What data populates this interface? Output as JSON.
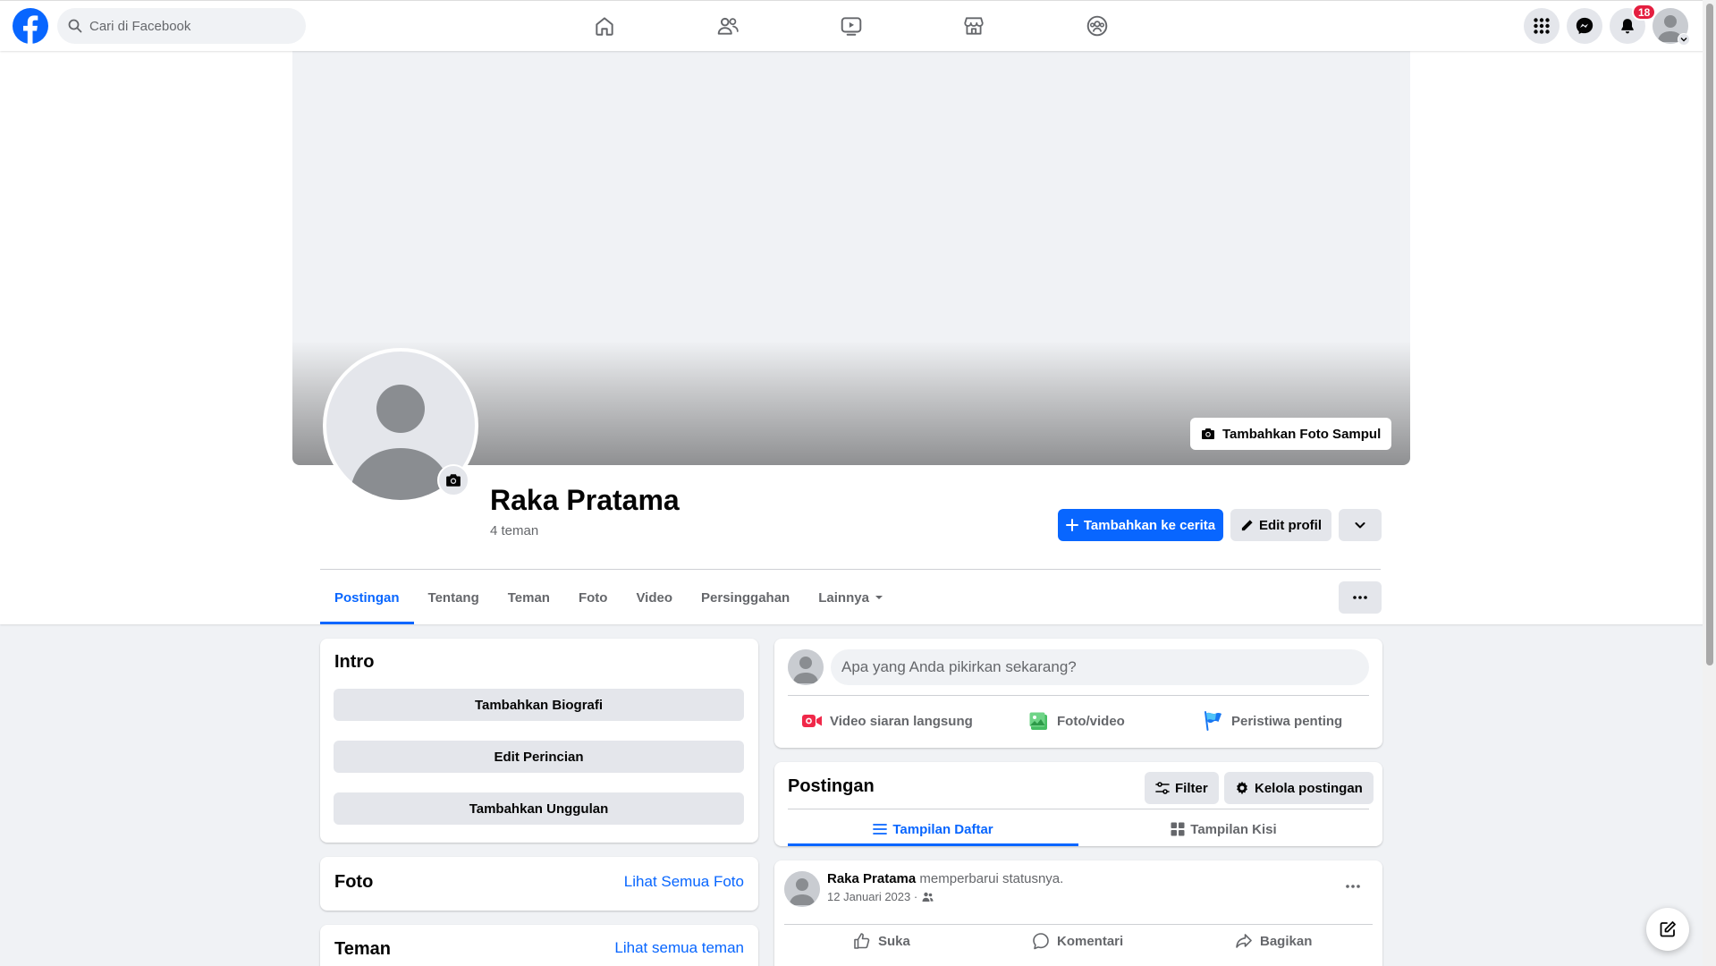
{
  "topbar": {
    "search_placeholder": "Cari di Facebook",
    "notification_count": "18"
  },
  "profile": {
    "cover_button": "Tambahkan Foto Sampul",
    "name": "Raka Pratama",
    "friend_count": "4 teman",
    "add_story": "Tambahkan ke cerita",
    "edit_profile": "Edit profil"
  },
  "tabs": [
    {
      "label": "Postingan"
    },
    {
      "label": "Tentang"
    },
    {
      "label": "Teman"
    },
    {
      "label": "Foto"
    },
    {
      "label": "Video"
    },
    {
      "label": "Persinggahan"
    },
    {
      "label": "Lainnya"
    }
  ],
  "intro": {
    "title": "Intro",
    "buttons": [
      "Tambahkan Biografi",
      "Edit Perincian",
      "Tambahkan Unggulan"
    ]
  },
  "photos": {
    "title": "Foto",
    "link": "Lihat Semua Foto"
  },
  "friends": {
    "title": "Teman",
    "link": "Lihat semua teman"
  },
  "composer": {
    "placeholder": "Apa yang Anda pikirkan sekarang?",
    "actions": [
      "Video siaran langsung",
      "Foto/video",
      "Peristiwa penting"
    ]
  },
  "posts_section": {
    "title": "Postingan",
    "filter": "Filter",
    "manage": "Kelola postingan",
    "list_view": "Tampilan Daftar",
    "grid_view": "Tampilan Kisi"
  },
  "post": {
    "author": "Raka Pratama",
    "action_text": "memperbarui statusnya.",
    "date": "12 Januari 2023 ·",
    "like": "Suka",
    "comment": "Komentari",
    "share": "Bagikan"
  },
  "colors": {
    "brand": "#0866ff",
    "badge": "#e41e3f",
    "live": "#f02849",
    "photo": "#45bd62",
    "event": "#1877f2"
  }
}
